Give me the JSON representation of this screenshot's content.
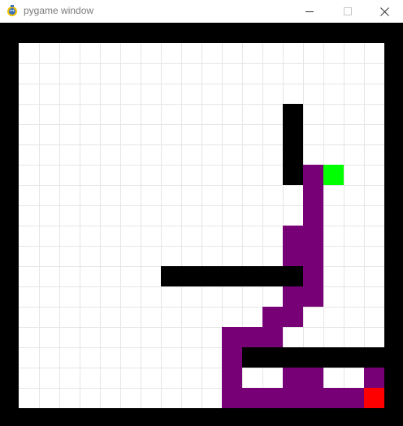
{
  "window": {
    "title": "pygame window",
    "icon": "pygame-snake-icon",
    "buttons": [
      "minimize-icon",
      "maximize-icon",
      "close-icon"
    ]
  },
  "game": {
    "grid": {
      "columns": 18,
      "rows": 18
    },
    "colors": {
      "background": "#ffffff",
      "gridline": "#e6e6e6",
      "border": "#000000",
      "wall": "#000000",
      "path": "#770077",
      "start": "#00ff00",
      "goal": "#ff0000"
    },
    "start": [
      15,
      6
    ],
    "goal": [
      17,
      17
    ],
    "walls": [
      [
        13,
        3
      ],
      [
        13,
        4
      ],
      [
        13,
        5
      ],
      [
        13,
        6
      ],
      [
        7,
        11
      ],
      [
        8,
        11
      ],
      [
        9,
        11
      ],
      [
        10,
        11
      ],
      [
        11,
        11
      ],
      [
        12,
        11
      ],
      [
        13,
        11
      ],
      [
        11,
        15
      ],
      [
        12,
        15
      ],
      [
        13,
        15
      ],
      [
        14,
        15
      ],
      [
        15,
        15
      ],
      [
        16,
        15
      ],
      [
        17,
        15
      ]
    ],
    "path": [
      [
        14,
        6
      ],
      [
        14,
        7
      ],
      [
        14,
        8
      ],
      [
        13,
        9
      ],
      [
        14,
        9
      ],
      [
        13,
        10
      ],
      [
        14,
        10
      ],
      [
        13,
        11
      ],
      [
        14,
        11
      ],
      [
        13,
        12
      ],
      [
        14,
        12
      ],
      [
        12,
        13
      ],
      [
        13,
        13
      ],
      [
        10,
        14
      ],
      [
        11,
        14
      ],
      [
        12,
        14
      ],
      [
        10,
        15
      ],
      [
        10,
        16
      ],
      [
        13,
        16
      ],
      [
        14,
        16
      ],
      [
        17,
        16
      ],
      [
        10,
        17
      ],
      [
        11,
        17
      ],
      [
        12,
        17
      ],
      [
        13,
        17
      ],
      [
        14,
        17
      ],
      [
        15,
        17
      ],
      [
        16,
        17
      ]
    ]
  }
}
